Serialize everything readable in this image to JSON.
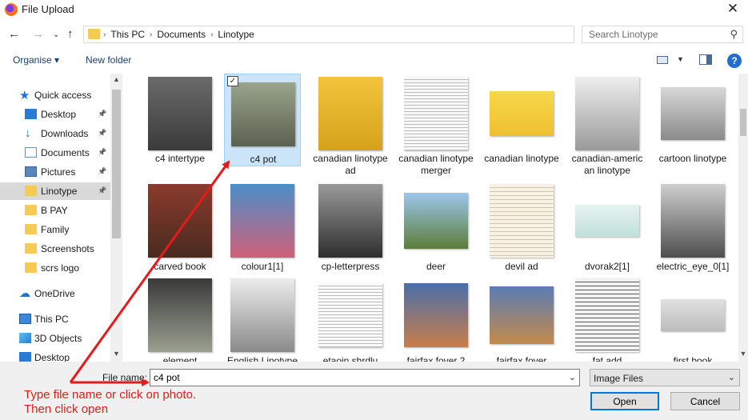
{
  "window": {
    "title": "File Upload",
    "close_icon": "close-icon"
  },
  "address": {
    "crumbs": [
      "This PC",
      "Documents",
      "Linotype"
    ],
    "search_placeholder": "Search Linotype"
  },
  "toolbar": {
    "organise_label": "Organise ▾",
    "new_folder_label": "New folder",
    "help_label": "?"
  },
  "sidebar": {
    "items": [
      {
        "label": "Quick access",
        "icon": "star-icon",
        "pinned": false
      },
      {
        "label": "Desktop",
        "icon": "desktop-icon",
        "pinned": true
      },
      {
        "label": "Downloads",
        "icon": "download-icon",
        "pinned": true
      },
      {
        "label": "Documents",
        "icon": "document-icon",
        "pinned": true
      },
      {
        "label": "Pictures",
        "icon": "pictures-icon",
        "pinned": true
      },
      {
        "label": "Linotype",
        "icon": "folder-icon",
        "pinned": true,
        "selected": true
      },
      {
        "label": "B PAY",
        "icon": "folder-icon",
        "pinned": false
      },
      {
        "label": "Family",
        "icon": "folder-icon",
        "pinned": false
      },
      {
        "label": "Screenshots",
        "icon": "folder-icon",
        "pinned": false
      },
      {
        "label": "scrs logo",
        "icon": "folder-icon",
        "pinned": false
      },
      {
        "label": "OneDrive",
        "icon": "cloud-icon",
        "pinned": false
      },
      {
        "label": "This PC",
        "icon": "computer-icon",
        "pinned": false
      },
      {
        "label": "3D Objects",
        "icon": "cube-icon",
        "pinned": false
      },
      {
        "label": "Desktop",
        "icon": "desktop-icon",
        "pinned": false
      }
    ]
  },
  "files": [
    {
      "label": "c4 intertype"
    },
    {
      "label": "c4 pot",
      "selected": true
    },
    {
      "label": "canadian linotype ad"
    },
    {
      "label": "canadian linotype merger"
    },
    {
      "label": "canadian linotype"
    },
    {
      "label": "canadian-americ an linotype"
    },
    {
      "label": "cartoon linotype"
    },
    {
      "label": "carved book"
    },
    {
      "label": "colour1[1]"
    },
    {
      "label": "cp-letterpress"
    },
    {
      "label": "deer"
    },
    {
      "label": "devil ad"
    },
    {
      "label": "dvorak2[1]"
    },
    {
      "label": "electric_eye_0[1]"
    },
    {
      "label": "element"
    },
    {
      "label": "English Linotype"
    },
    {
      "label": "etaoin shrdlu"
    },
    {
      "label": "fairfax fover 2"
    },
    {
      "label": "fairfax fover"
    },
    {
      "label": "fat add"
    },
    {
      "label": "first book"
    }
  ],
  "bottom": {
    "file_name_label": "File name:",
    "file_name_value": "c4 pot",
    "file_type_value": "Image Files",
    "open_label": "Open",
    "cancel_label": "Cancel"
  },
  "annotation": {
    "line1": "Type file name or click on photo.",
    "line2": "Then click open",
    "color": "#e31b1b"
  }
}
